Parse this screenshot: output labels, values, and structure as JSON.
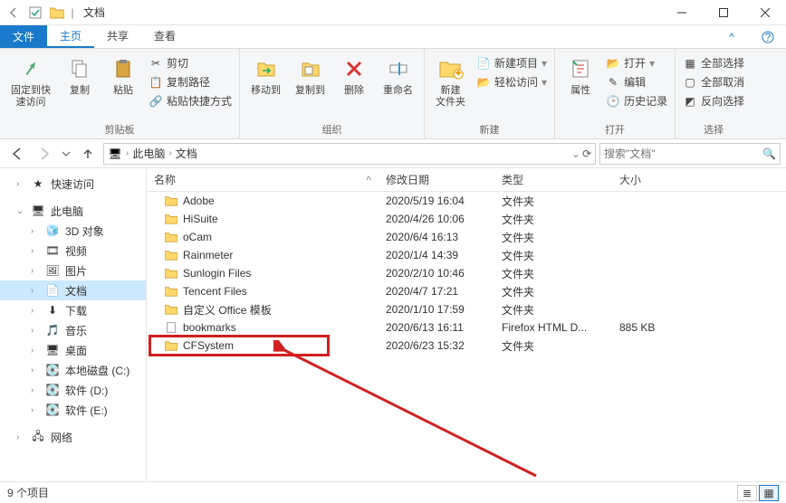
{
  "title": "文档",
  "tabs": {
    "file": "文件",
    "home": "主页",
    "share": "共享",
    "view": "查看"
  },
  "ribbon": {
    "clipboard": {
      "label": "剪贴板",
      "pin": "固定到快\n速访问",
      "copy": "复制",
      "paste": "粘贴",
      "cut": "剪切",
      "copy_path": "复制路径",
      "paste_shortcut": "粘贴快捷方式"
    },
    "organize": {
      "label": "组织",
      "move_to": "移动到",
      "copy_to": "复制到",
      "delete": "删除",
      "rename": "重命名"
    },
    "new": {
      "label": "新建",
      "new_folder": "新建\n文件夹",
      "new_item": "新建项目",
      "easy_access": "轻松访问"
    },
    "open": {
      "label": "打开",
      "properties": "属性",
      "open": "打开",
      "edit": "编辑",
      "history": "历史记录"
    },
    "select": {
      "label": "选择",
      "select_all": "全部选择",
      "select_none": "全部取消",
      "invert": "反向选择"
    }
  },
  "breadcrumb": {
    "pc": "此电脑",
    "docs": "文档"
  },
  "search_placeholder": "搜索\"文档\"",
  "columns": {
    "name": "名称",
    "date": "修改日期",
    "type": "类型",
    "size": "大小"
  },
  "sidebar": {
    "quick_access": "快速访问",
    "this_pc": "此电脑",
    "objects3d": "3D 对象",
    "videos": "视频",
    "pictures": "图片",
    "documents": "文档",
    "downloads": "下载",
    "music": "音乐",
    "desktop": "桌面",
    "disk_c": "本地磁盘 (C:)",
    "disk_d": "软件 (D:)",
    "disk_e": "软件 (E:)",
    "network": "网络"
  },
  "rows": [
    {
      "name": "Adobe",
      "date": "2020/5/19 16:04",
      "type": "文件夹",
      "size": "",
      "icon": "folder"
    },
    {
      "name": "HiSuite",
      "date": "2020/4/26 10:06",
      "type": "文件夹",
      "size": "",
      "icon": "folder"
    },
    {
      "name": "oCam",
      "date": "2020/6/4 16:13",
      "type": "文件夹",
      "size": "",
      "icon": "folder"
    },
    {
      "name": "Rainmeter",
      "date": "2020/1/4 14:39",
      "type": "文件夹",
      "size": "",
      "icon": "folder"
    },
    {
      "name": "Sunlogin Files",
      "date": "2020/2/10 10:46",
      "type": "文件夹",
      "size": "",
      "icon": "folder"
    },
    {
      "name": "Tencent Files",
      "date": "2020/4/7 17:21",
      "type": "文件夹",
      "size": "",
      "icon": "folder"
    },
    {
      "name": "自定义 Office 模板",
      "date": "2020/1/10 17:59",
      "type": "文件夹",
      "size": "",
      "icon": "folder"
    },
    {
      "name": "bookmarks",
      "date": "2020/6/13 16:11",
      "type": "Firefox HTML D...",
      "size": "885 KB",
      "icon": "file"
    },
    {
      "name": "CFSystem",
      "date": "2020/6/23 15:32",
      "type": "文件夹",
      "size": "",
      "icon": "folder"
    }
  ],
  "status": "9 个项目"
}
